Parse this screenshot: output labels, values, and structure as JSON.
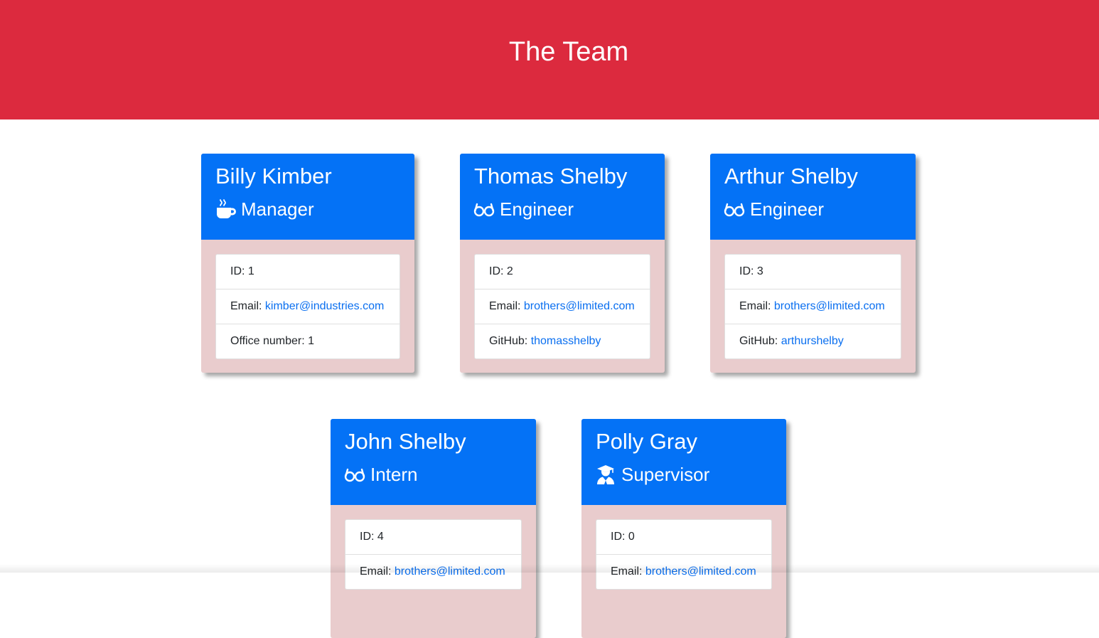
{
  "header": {
    "title": "The Team",
    "background_color": "#dc2a3e"
  },
  "colors": {
    "card_header": "#0472f6",
    "card_body": "#e9cccd",
    "link": "#0a6ff0"
  },
  "team": [
    {
      "name": "Billy Kimber",
      "role": "Manager",
      "icon": "coffee-mug-icon",
      "id_label": "ID: ",
      "id": "1",
      "email_label": "Email: ",
      "email": "kimber@industries.com",
      "extra_label": "Office number: ",
      "extra_value": "1"
    },
    {
      "name": "Thomas Shelby",
      "role": "Engineer",
      "icon": "glasses-icon",
      "id_label": "ID: ",
      "id": "2",
      "email_label": "Email: ",
      "email": "brothers@limited.com",
      "extra_label": "GitHub: ",
      "extra_value": "thomasshelby"
    },
    {
      "name": "Arthur Shelby",
      "role": "Engineer",
      "icon": "glasses-icon",
      "id_label": "ID: ",
      "id": "3",
      "email_label": "Email: ",
      "email": "brothers@limited.com",
      "extra_label": "GitHub: ",
      "extra_value": "arthurshelby"
    },
    {
      "name": "John Shelby",
      "role": "Intern",
      "icon": "glasses-icon",
      "id_label": "ID: ",
      "id": "4",
      "email_label": "Email: ",
      "email": "brothers@limited.com"
    },
    {
      "name": "Polly Gray",
      "role": "Supervisor",
      "icon": "graduate-icon",
      "id_label": "ID: ",
      "id": "0",
      "email_label": "Email: ",
      "email": "brothers@limited.com"
    }
  ]
}
